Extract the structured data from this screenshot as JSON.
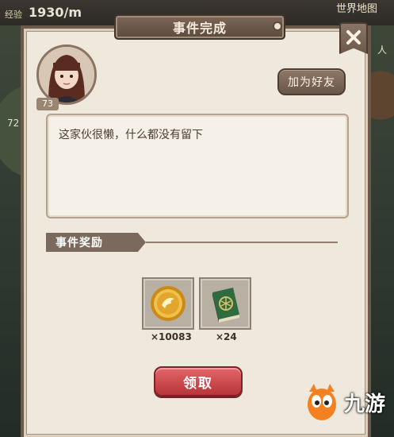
{
  "hud": {
    "exp_label": "经验",
    "speed": "1930/m",
    "map_label": "世界地图",
    "left_num": "72",
    "right_person": "人"
  },
  "dialog": {
    "title": "事件完成",
    "close_icon": "close-icon",
    "level": "73",
    "friend_button": "加为好友",
    "message": "这家伙很懒，什么都没有留下",
    "reward_header": "事件奖励",
    "claim_button": "领取"
  },
  "rewards": [
    {
      "icon": "gold-coin-icon",
      "qty": "×10083"
    },
    {
      "icon": "green-book-icon",
      "qty": "×24"
    }
  ],
  "watermark": {
    "text": "九游"
  },
  "colors": {
    "claim": "#c9444a",
    "panel": "#efe8dc",
    "frame": "#6b5a4c"
  }
}
